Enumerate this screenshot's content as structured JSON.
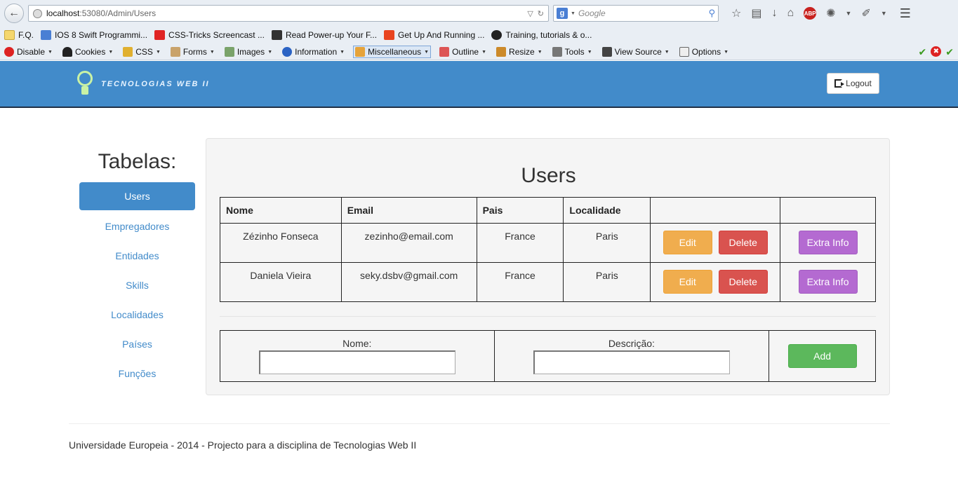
{
  "browser": {
    "url_host": "localhost",
    "url_path": ":53080/Admin/Users",
    "search_placeholder": "Google",
    "search_engine_badge": "g",
    "abp_label": "ABP",
    "bookmarks": [
      {
        "label": "F.Q.",
        "icon": "folder-icon"
      },
      {
        "label": "IOS 8 Swift Programmi...",
        "icon": "google-icon"
      },
      {
        "label": "CSS-Tricks Screencast ...",
        "icon": "youtube-icon"
      },
      {
        "label": "Read Power-up Your F...",
        "icon": "book-icon"
      },
      {
        "label": "Get Up And Running ...",
        "icon": "swift-icon"
      },
      {
        "label": "Training, tutorials & o...",
        "icon": "globe-icon"
      }
    ],
    "devbar": [
      {
        "label": "Disable",
        "icon": "disable-icon"
      },
      {
        "label": "Cookies",
        "icon": "cookies-icon"
      },
      {
        "label": "CSS",
        "icon": "css-icon"
      },
      {
        "label": "Forms",
        "icon": "forms-icon"
      },
      {
        "label": "Images",
        "icon": "images-icon"
      },
      {
        "label": "Information",
        "icon": "info-icon"
      },
      {
        "label": "Miscellaneous",
        "icon": "misc-icon",
        "active": true
      },
      {
        "label": "Outline",
        "icon": "outline-icon"
      },
      {
        "label": "Resize",
        "icon": "resize-icon"
      },
      {
        "label": "Tools",
        "icon": "tools-icon"
      },
      {
        "label": "View Source",
        "icon": "view-source-icon"
      },
      {
        "label": "Options",
        "icon": "options-icon"
      }
    ]
  },
  "header": {
    "brand_text": "Tecnologias Web II",
    "logout_label": "Logout",
    "color": "#428bca"
  },
  "sidebar": {
    "title": "Tabelas:",
    "items": [
      {
        "label": "Users",
        "active": true
      },
      {
        "label": "Empregadores"
      },
      {
        "label": "Entidades"
      },
      {
        "label": "Skills"
      },
      {
        "label": "Localidades"
      },
      {
        "label": "Países"
      },
      {
        "label": "Funções"
      }
    ]
  },
  "main": {
    "title": "Users",
    "columns": [
      "Nome",
      "Email",
      "Pais",
      "Localidade",
      "",
      ""
    ],
    "rows": [
      {
        "nome": "Zézinho Fonseca",
        "email": "zezinho@email.com",
        "pais": "France",
        "localidade": "Paris"
      },
      {
        "nome": "Daniela Vieira",
        "email": "seky.dsbv@gmail.com",
        "pais": "France",
        "localidade": "Paris"
      }
    ],
    "row_actions": {
      "edit": "Edit",
      "delete": "Delete",
      "extra": "Extra Info"
    },
    "form": {
      "nome_label": "Nome:",
      "nome_value": "",
      "descricao_label": "Descrição:",
      "descricao_value": "",
      "add_label": "Add"
    }
  },
  "footer": {
    "text": "Universidade Europeia - 2014 - Projecto para a disciplina de Tecnologias Web II"
  }
}
